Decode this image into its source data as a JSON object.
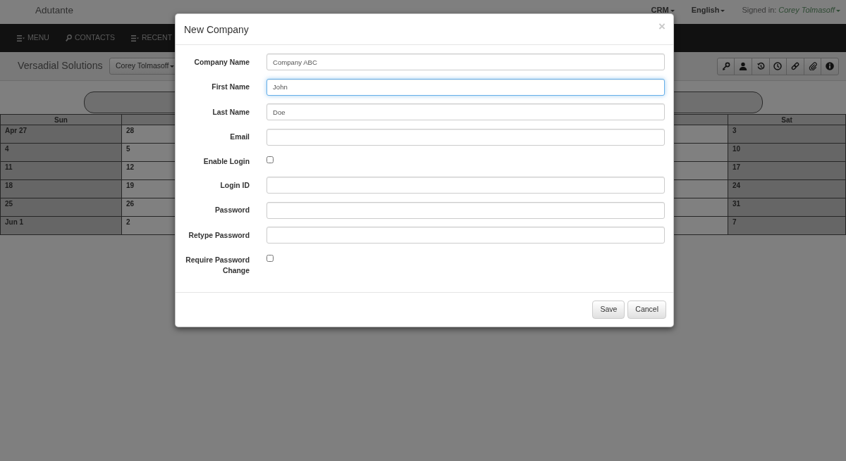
{
  "top_bar": {
    "brand": "Adutante",
    "menus": [
      {
        "label": "CRM"
      },
      {
        "label": "English"
      }
    ],
    "signed_in_label": "Signed in:",
    "user": "Corey Tolmasoff"
  },
  "nav_bar": {
    "items": [
      {
        "label": "MENU"
      },
      {
        "label": "CONTACTS"
      },
      {
        "label": "RECENT"
      }
    ]
  },
  "sub_header": {
    "company": "Versadial Solutions",
    "user_dropdown": "Corey Tolmasoff"
  },
  "calendar": {
    "columns": [
      {
        "heading": "Sun",
        "weekend": true,
        "dates": [
          "Apr 27",
          "4",
          "11",
          "18",
          "25",
          "Jun 1"
        ]
      },
      {
        "weekend": false,
        "dates": [
          "28",
          "5",
          "12",
          "19",
          "26",
          "2"
        ]
      },
      {
        "weekend": false
      },
      {
        "heading": "Sat",
        "weekend": true,
        "dates": [
          "3",
          "10",
          "17",
          "24",
          "31",
          "7"
        ]
      }
    ]
  },
  "dialog": {
    "title": "New Company",
    "close": "×",
    "fields": [
      {
        "kind": "text",
        "label": "Company Name",
        "value": "Company ABC",
        "focused": false
      },
      {
        "kind": "text",
        "label": "First Name",
        "value": "John",
        "focused": true
      },
      {
        "kind": "text",
        "label": "Last Name",
        "value": "Doe",
        "focused": false
      },
      {
        "kind": "text",
        "label": "Email",
        "focused": false
      },
      {
        "kind": "checkbox",
        "label": "Enable Login",
        "checked": false
      },
      {
        "kind": "text",
        "label": "Login ID",
        "focused": false
      },
      {
        "kind": "text",
        "label": "Password",
        "focused": false
      },
      {
        "kind": "text",
        "label": "Retype Password",
        "focused": false
      },
      {
        "kind": "checkbox",
        "label": "Require Password Change",
        "checked": false
      }
    ],
    "buttons": [
      {
        "label": "Save"
      },
      {
        "label": "Cancel"
      }
    ]
  }
}
